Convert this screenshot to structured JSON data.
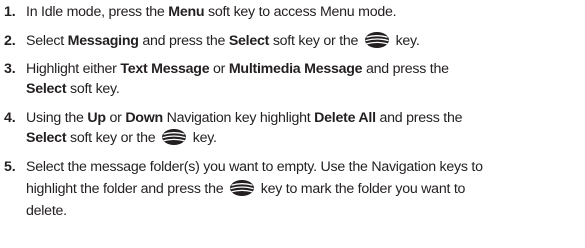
{
  "steps": [
    {
      "number": "1.",
      "lines": [
        [
          "In Idle mode, press the ",
          "Menu",
          " soft key to access Menu mode."
        ]
      ]
    },
    {
      "number": "2.",
      "lines": [
        [
          "Select ",
          "Messaging",
          " and press the ",
          "Select",
          " soft key or the ",
          "",
          " key."
        ]
      ]
    },
    {
      "number": "3.",
      "lines": [
        [
          "Highlight either ",
          "Text Message",
          " or ",
          "Multimedia Message",
          " and press the"
        ],
        [
          "",
          "Select",
          " soft key."
        ]
      ]
    },
    {
      "number": "4.",
      "lines": [
        [
          "Using the ",
          "Up",
          " or ",
          "Down",
          " Navigation key highlight ",
          "Delete All",
          " and press the"
        ],
        [
          "",
          "Select",
          " soft key or the ",
          "",
          " key."
        ]
      ]
    },
    {
      "number": "5.",
      "lines": [
        [
          "Select the message folder(s) you want to empty. Use the Navigation keys to"
        ],
        [
          "highlight the folder and press the ",
          "",
          " key to mark the folder you want to"
        ],
        [
          "delete."
        ]
      ]
    }
  ],
  "icons": {
    "key_icon": "att-globe-icon"
  }
}
